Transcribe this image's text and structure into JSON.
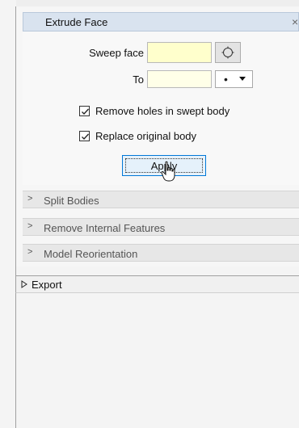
{
  "extrude_face": {
    "title": "Extrude Face",
    "close_glyph": "×",
    "sweep_face_label": "Sweep face",
    "sweep_face_value": "",
    "to_label": "To",
    "to_value": "",
    "to_mode_selected": "•",
    "remove_holes": {
      "label": "Remove holes in swept body",
      "checked": true
    },
    "replace_original": {
      "label": "Replace original body",
      "checked": true
    },
    "apply_label": "Apply"
  },
  "collapsed_sections": [
    {
      "label": "Split Bodies",
      "chevron": ">"
    },
    {
      "label": "Remove Internal Features",
      "chevron": ">"
    },
    {
      "label": "Model Reorientation",
      "chevron": ">"
    }
  ],
  "export": {
    "label": "Export"
  },
  "colors": {
    "accent": "#0078d7",
    "field_yellow": "#ffffcc",
    "header_blue": "#d9e3ef"
  },
  "icons": {
    "pick": "circle-select-icon",
    "dropdown": "chevron-down-icon",
    "check": "checkmark-icon",
    "cursor": "hand-pointer-icon",
    "export": "triangle-right-icon"
  }
}
